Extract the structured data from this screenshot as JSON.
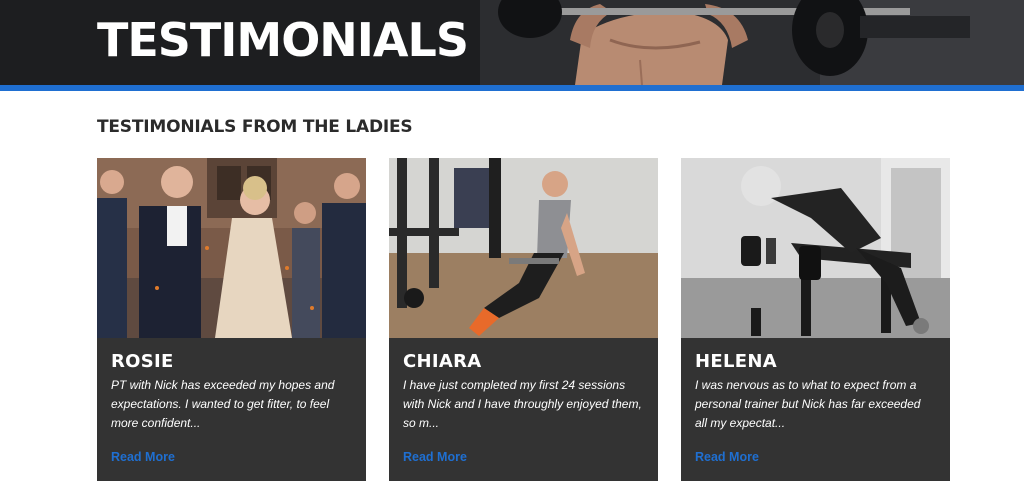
{
  "hero": {
    "title": "TESTIMONIALS"
  },
  "section": {
    "title": "TESTIMONIALS FROM THE LADIES"
  },
  "colors": {
    "accent": "#1f6fd1",
    "card_bg": "#333333"
  },
  "cards": [
    {
      "name": "ROSIE",
      "text": "PT with Nick has exceeded my hopes and expectations. I wanted to get fitter, to feel more confident...",
      "link": "Read More"
    },
    {
      "name": "CHIARA",
      "text": "I have just completed my first 24 sessions with Nick and I have throughly enjoyed them, so m...",
      "link": "Read More"
    },
    {
      "name": "HELENA",
      "text": "I was nervous as to what to expect from a personal trainer but Nick has far exceeded all my expectat...",
      "link": "Read More"
    }
  ]
}
